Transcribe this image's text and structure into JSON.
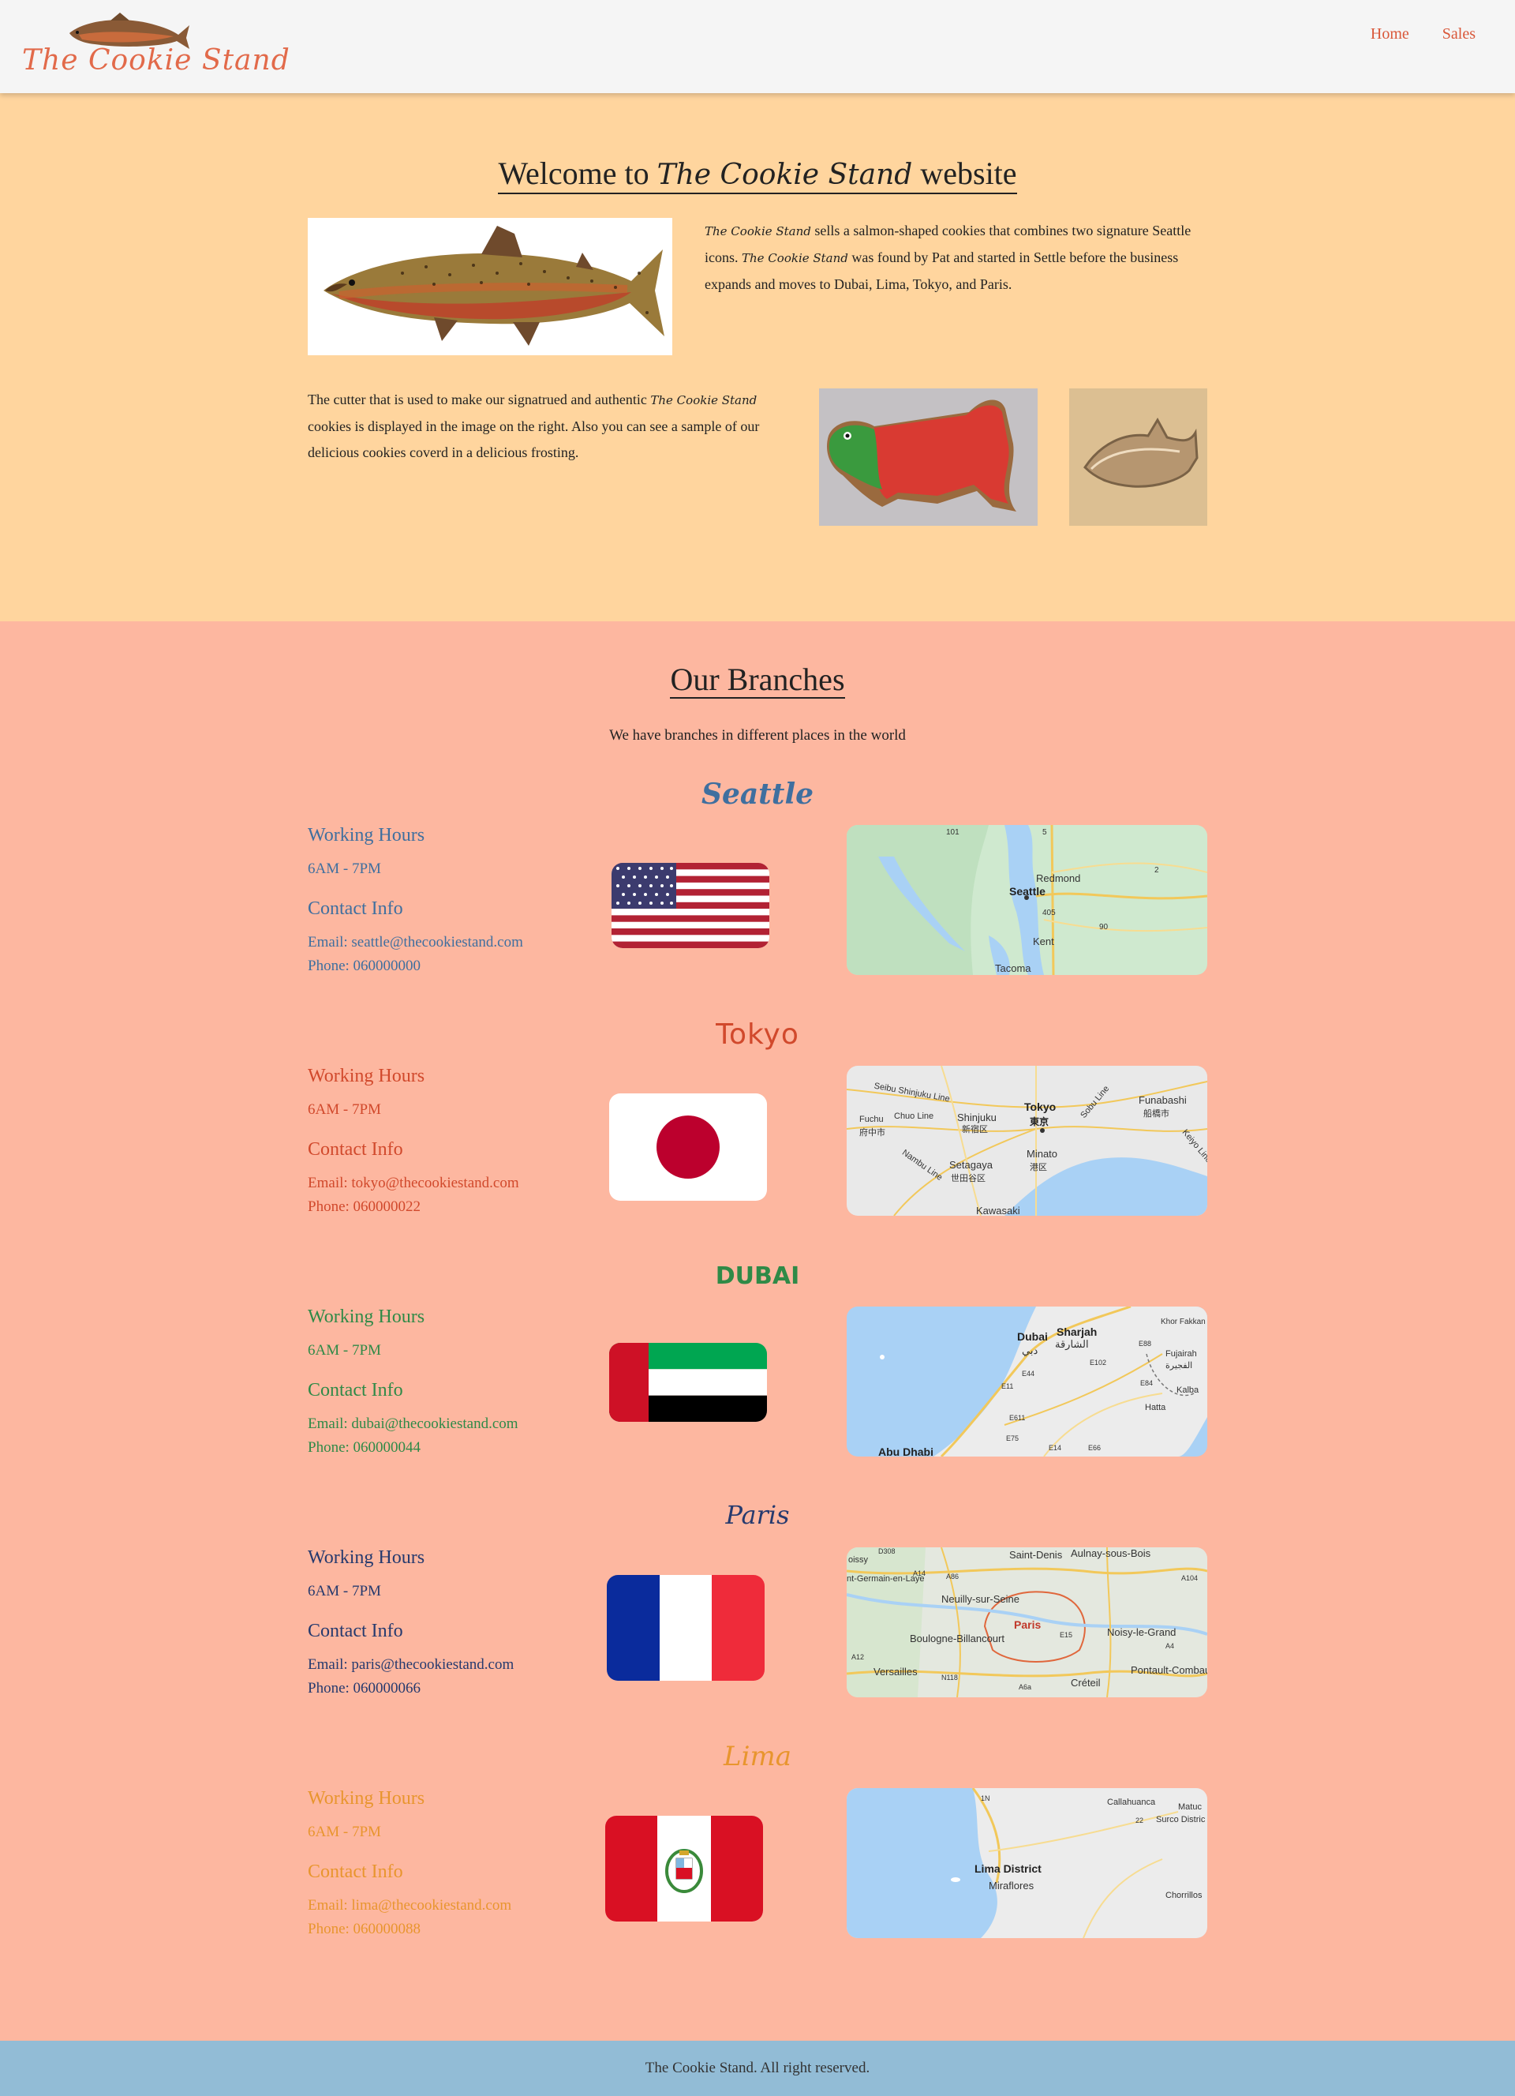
{
  "header": {
    "logo_text": "The Cookie Stand",
    "nav": [
      {
        "label": "Home"
      },
      {
        "label": "Sales"
      }
    ]
  },
  "welcome": {
    "title_prefix": "Welcome to",
    "title_brand": "The Cookie Stand",
    "title_suffix": "website",
    "intro_brand": "The Cookie Stand",
    "intro_text_1": " sells a salmon-shaped cookies that combines two signature Seattle icons. ",
    "intro_brand_2": "The Cookie Stand",
    "intro_text_2": " was found by Pat and started in Settle before the business expands and moves to Dubai, Lima, Tokyo, and Paris.",
    "cutter_text_1": "The cutter that is used to make our signatrued and authentic ",
    "cutter_brand": "The Cookie Stand",
    "cutter_text_2": " cookies is displayed in the image on the right. Also you can see a sample of our delicious cookies coverd in a delicious frosting."
  },
  "branches": {
    "title": "Our Branches",
    "subtitle": "We have branches in different places in the world",
    "items": [
      {
        "city": "Seattle",
        "color": "#3f6f9f",
        "hours_label": "Working Hours",
        "hours": "6AM - 7PM",
        "contact_label": "Contact Info",
        "email": "Email: seattle@thecookiestand.com",
        "phone": "Phone: 060000000",
        "flag": "us-flag",
        "map_labels": [
          "Seattle",
          "Redmond",
          "Kent",
          "Tacoma",
          "101",
          "5",
          "2",
          "405",
          "90"
        ]
      },
      {
        "city": "Tokyo",
        "color": "#d1492c",
        "hours_label": "Working Hours",
        "hours": "6AM - 7PM",
        "contact_label": "Contact Info",
        "email": "Email: tokyo@thecookiestand.com",
        "phone": "Phone: 060000022",
        "flag": "japan-flag",
        "map_labels": [
          "Tokyo",
          "東京",
          "Shinjuku",
          "新宿区",
          "Minato",
          "港区",
          "Setagaya",
          "世田谷区",
          "Funabashi",
          "船橋市",
          "Seibu Shinjuku Line",
          "Chuo Line",
          "Fuchu",
          "府中市",
          "Nambu Line",
          "Sobu Line",
          "Keiyo Line",
          "Kawasaki"
        ]
      },
      {
        "city": "DUBAI",
        "color": "#2f8a47",
        "hours_label": "Working Hours",
        "hours": "6AM - 7PM",
        "contact_label": "Contact Info",
        "email": "Email: dubai@thecookiestand.com",
        "phone": "Phone: 060000044",
        "flag": "uae-flag",
        "map_labels": [
          "Dubai",
          "دبي",
          "Sharjah",
          "الشارقة",
          "Khor Fakkan",
          "Fujairah",
          "الفجيرة",
          "Kalba",
          "Hatta",
          "Abu Dhabi",
          "E11",
          "E611",
          "E44",
          "E102",
          "E88",
          "E84",
          "E66",
          "E75",
          "E14"
        ]
      },
      {
        "city": "Paris",
        "color": "#263a6e",
        "hours_label": "Working Hours",
        "hours": "6AM - 7PM",
        "contact_label": "Contact Info",
        "email": "Email: paris@thecookiestand.com",
        "phone": "Phone: 060000066",
        "flag": "france-flag",
        "map_labels": [
          "Paris",
          "Saint-Denis",
          "Aulnay-sous-Bois",
          "Neuilly-sur-Seine",
          "Boulogne-Billancourt",
          "Noisy-le-Grand",
          "Versailles",
          "Créteil",
          "Pontault-Combault",
          "nt-Germain-en-Laye",
          "oissy",
          "D308",
          "A14",
          "A86",
          "A104",
          "A12",
          "N118",
          "A6a",
          "E15",
          "A4"
        ]
      },
      {
        "city": "Lima",
        "color": "#e8952e",
        "hours_label": "Working Hours",
        "hours": "6AM - 7PM",
        "contact_label": "Contact Info",
        "email": "Email: lima@thecookiestand.com",
        "phone": "Phone: 060000088",
        "flag": "peru-flag",
        "map_labels": [
          "Lima District",
          "Miraflores",
          "Callahuanca",
          "Matuc",
          "Surco Distric",
          "Chorrillos",
          "1N",
          "22"
        ]
      }
    ]
  },
  "footer": {
    "text": "The Cookie Stand. All right reserved."
  }
}
